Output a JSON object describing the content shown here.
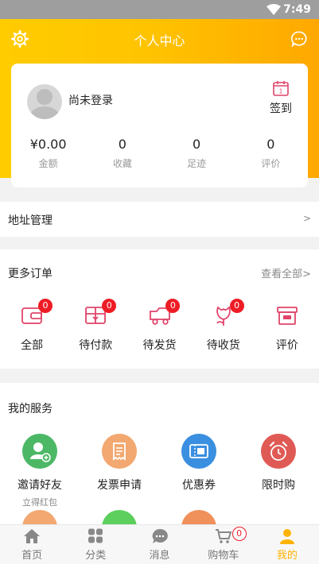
{
  "status_bar": {
    "time": "7:49"
  },
  "header": {
    "title": "个人中心"
  },
  "profile": {
    "login_text": "尚未登录",
    "signin_label": "签到"
  },
  "stats": [
    {
      "value": "¥0.00",
      "label": "金额"
    },
    {
      "value": "0",
      "label": "收藏"
    },
    {
      "value": "0",
      "label": "足迹"
    },
    {
      "value": "0",
      "label": "评价"
    }
  ],
  "address": {
    "label": "地址管理",
    "arrow": ">"
  },
  "orders": {
    "title": "更多订单",
    "view_all": "查看全部>",
    "items": [
      {
        "label": "全部",
        "badge": "0",
        "icon": "wallet-icon"
      },
      {
        "label": "待付款",
        "badge": "0",
        "icon": "package-icon"
      },
      {
        "label": "待发货",
        "badge": "0",
        "icon": "truck-icon"
      },
      {
        "label": "待收货",
        "badge": "0",
        "icon": "flower-icon"
      },
      {
        "label": "评价",
        "icon": "box-icon"
      }
    ]
  },
  "services": {
    "title": "我的服务",
    "items": [
      {
        "label": "邀请好友",
        "sub": "立得红包",
        "color": "#4cb866",
        "icon": "add-user-icon"
      },
      {
        "label": "发票申请",
        "color": "#f2a870",
        "icon": "invoice-icon"
      },
      {
        "label": "优惠券",
        "color": "#3b8fe0",
        "icon": "coupon-icon"
      },
      {
        "label": "限时购",
        "color": "#e05a55",
        "icon": "alarm-clock-icon"
      }
    ],
    "row2_colors": [
      "#f2a870",
      "#5ccf5c",
      "#f0905a"
    ]
  },
  "tabbar": {
    "items": [
      {
        "label": "首页",
        "icon": "home-icon"
      },
      {
        "label": "分类",
        "icon": "grid-icon"
      },
      {
        "label": "消息",
        "icon": "chat-icon"
      },
      {
        "label": "购物车",
        "icon": "cart-icon",
        "badge": "0"
      },
      {
        "label": "我的",
        "icon": "person-icon",
        "active": true
      }
    ]
  },
  "colors": {
    "accent": "#ffb300",
    "badge": "#ee1c25",
    "order_icon": "#e0446a"
  }
}
